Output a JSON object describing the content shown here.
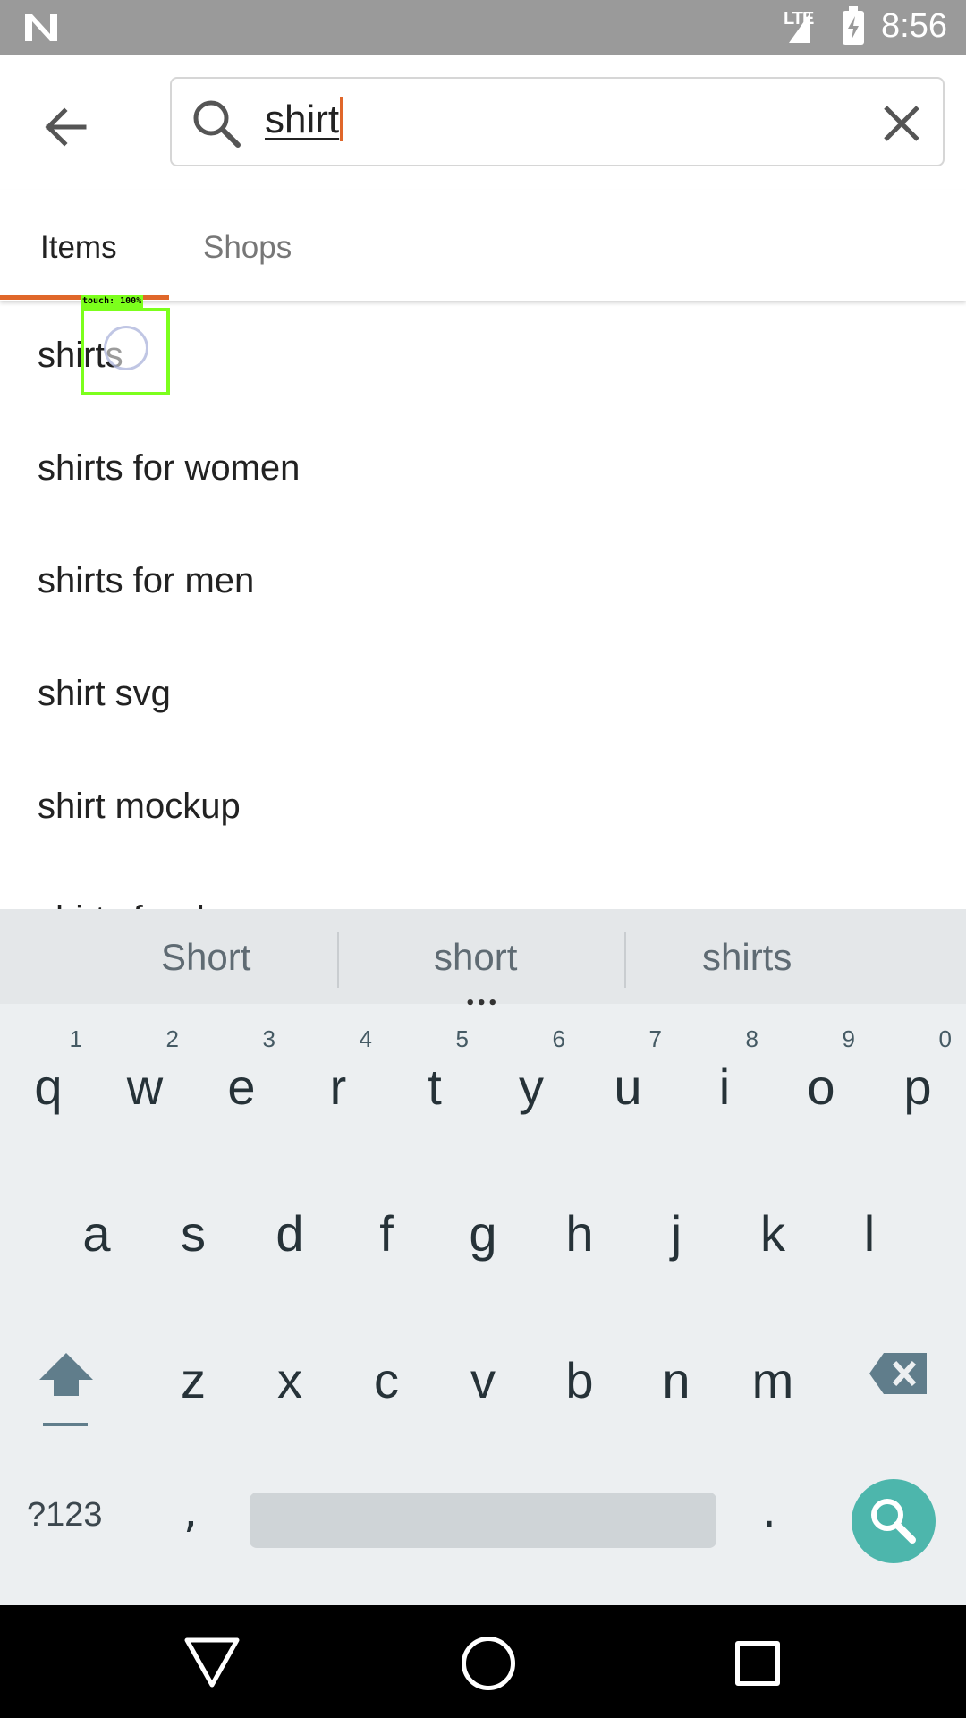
{
  "status_bar": {
    "time": "8:56",
    "network": "LTE",
    "icons": [
      "notification-n-icon",
      "signal-icon",
      "battery-charging-icon"
    ]
  },
  "search": {
    "query": "shirt",
    "back_icon": "arrow-left-icon",
    "search_icon": "search-icon",
    "clear_icon": "close-icon"
  },
  "tabs": [
    {
      "label": "Items",
      "selected": true
    },
    {
      "label": "Shops",
      "selected": false
    }
  ],
  "suggestions": [
    "shirts",
    "shirts for women",
    "shirts for men",
    "shirt svg",
    "shirt mockup",
    "shirts for dogs"
  ],
  "touch_overlay": {
    "label": "touch: 100%"
  },
  "keyboard": {
    "suggestions": [
      "Short",
      "short",
      "shirts"
    ],
    "row1": [
      {
        "key": "q",
        "num": "1"
      },
      {
        "key": "w",
        "num": "2"
      },
      {
        "key": "e",
        "num": "3"
      },
      {
        "key": "r",
        "num": "4"
      },
      {
        "key": "t",
        "num": "5"
      },
      {
        "key": "y",
        "num": "6"
      },
      {
        "key": "u",
        "num": "7"
      },
      {
        "key": "i",
        "num": "8"
      },
      {
        "key": "o",
        "num": "9"
      },
      {
        "key": "p",
        "num": "0"
      }
    ],
    "row2": [
      "a",
      "s",
      "d",
      "f",
      "g",
      "h",
      "j",
      "k",
      "l"
    ],
    "row3": [
      "z",
      "x",
      "c",
      "v",
      "b",
      "n",
      "m"
    ],
    "symbols_label": "?123",
    "comma": ",",
    "period": ".",
    "accent_color": "#4db6ac"
  },
  "colors": {
    "accent": "#e0672a",
    "status_bar": "#9a9a9a",
    "touch_box": "#7cff1c"
  },
  "nav_bar": {
    "icons": [
      "nav-back-icon",
      "nav-home-icon",
      "nav-recents-icon"
    ]
  }
}
